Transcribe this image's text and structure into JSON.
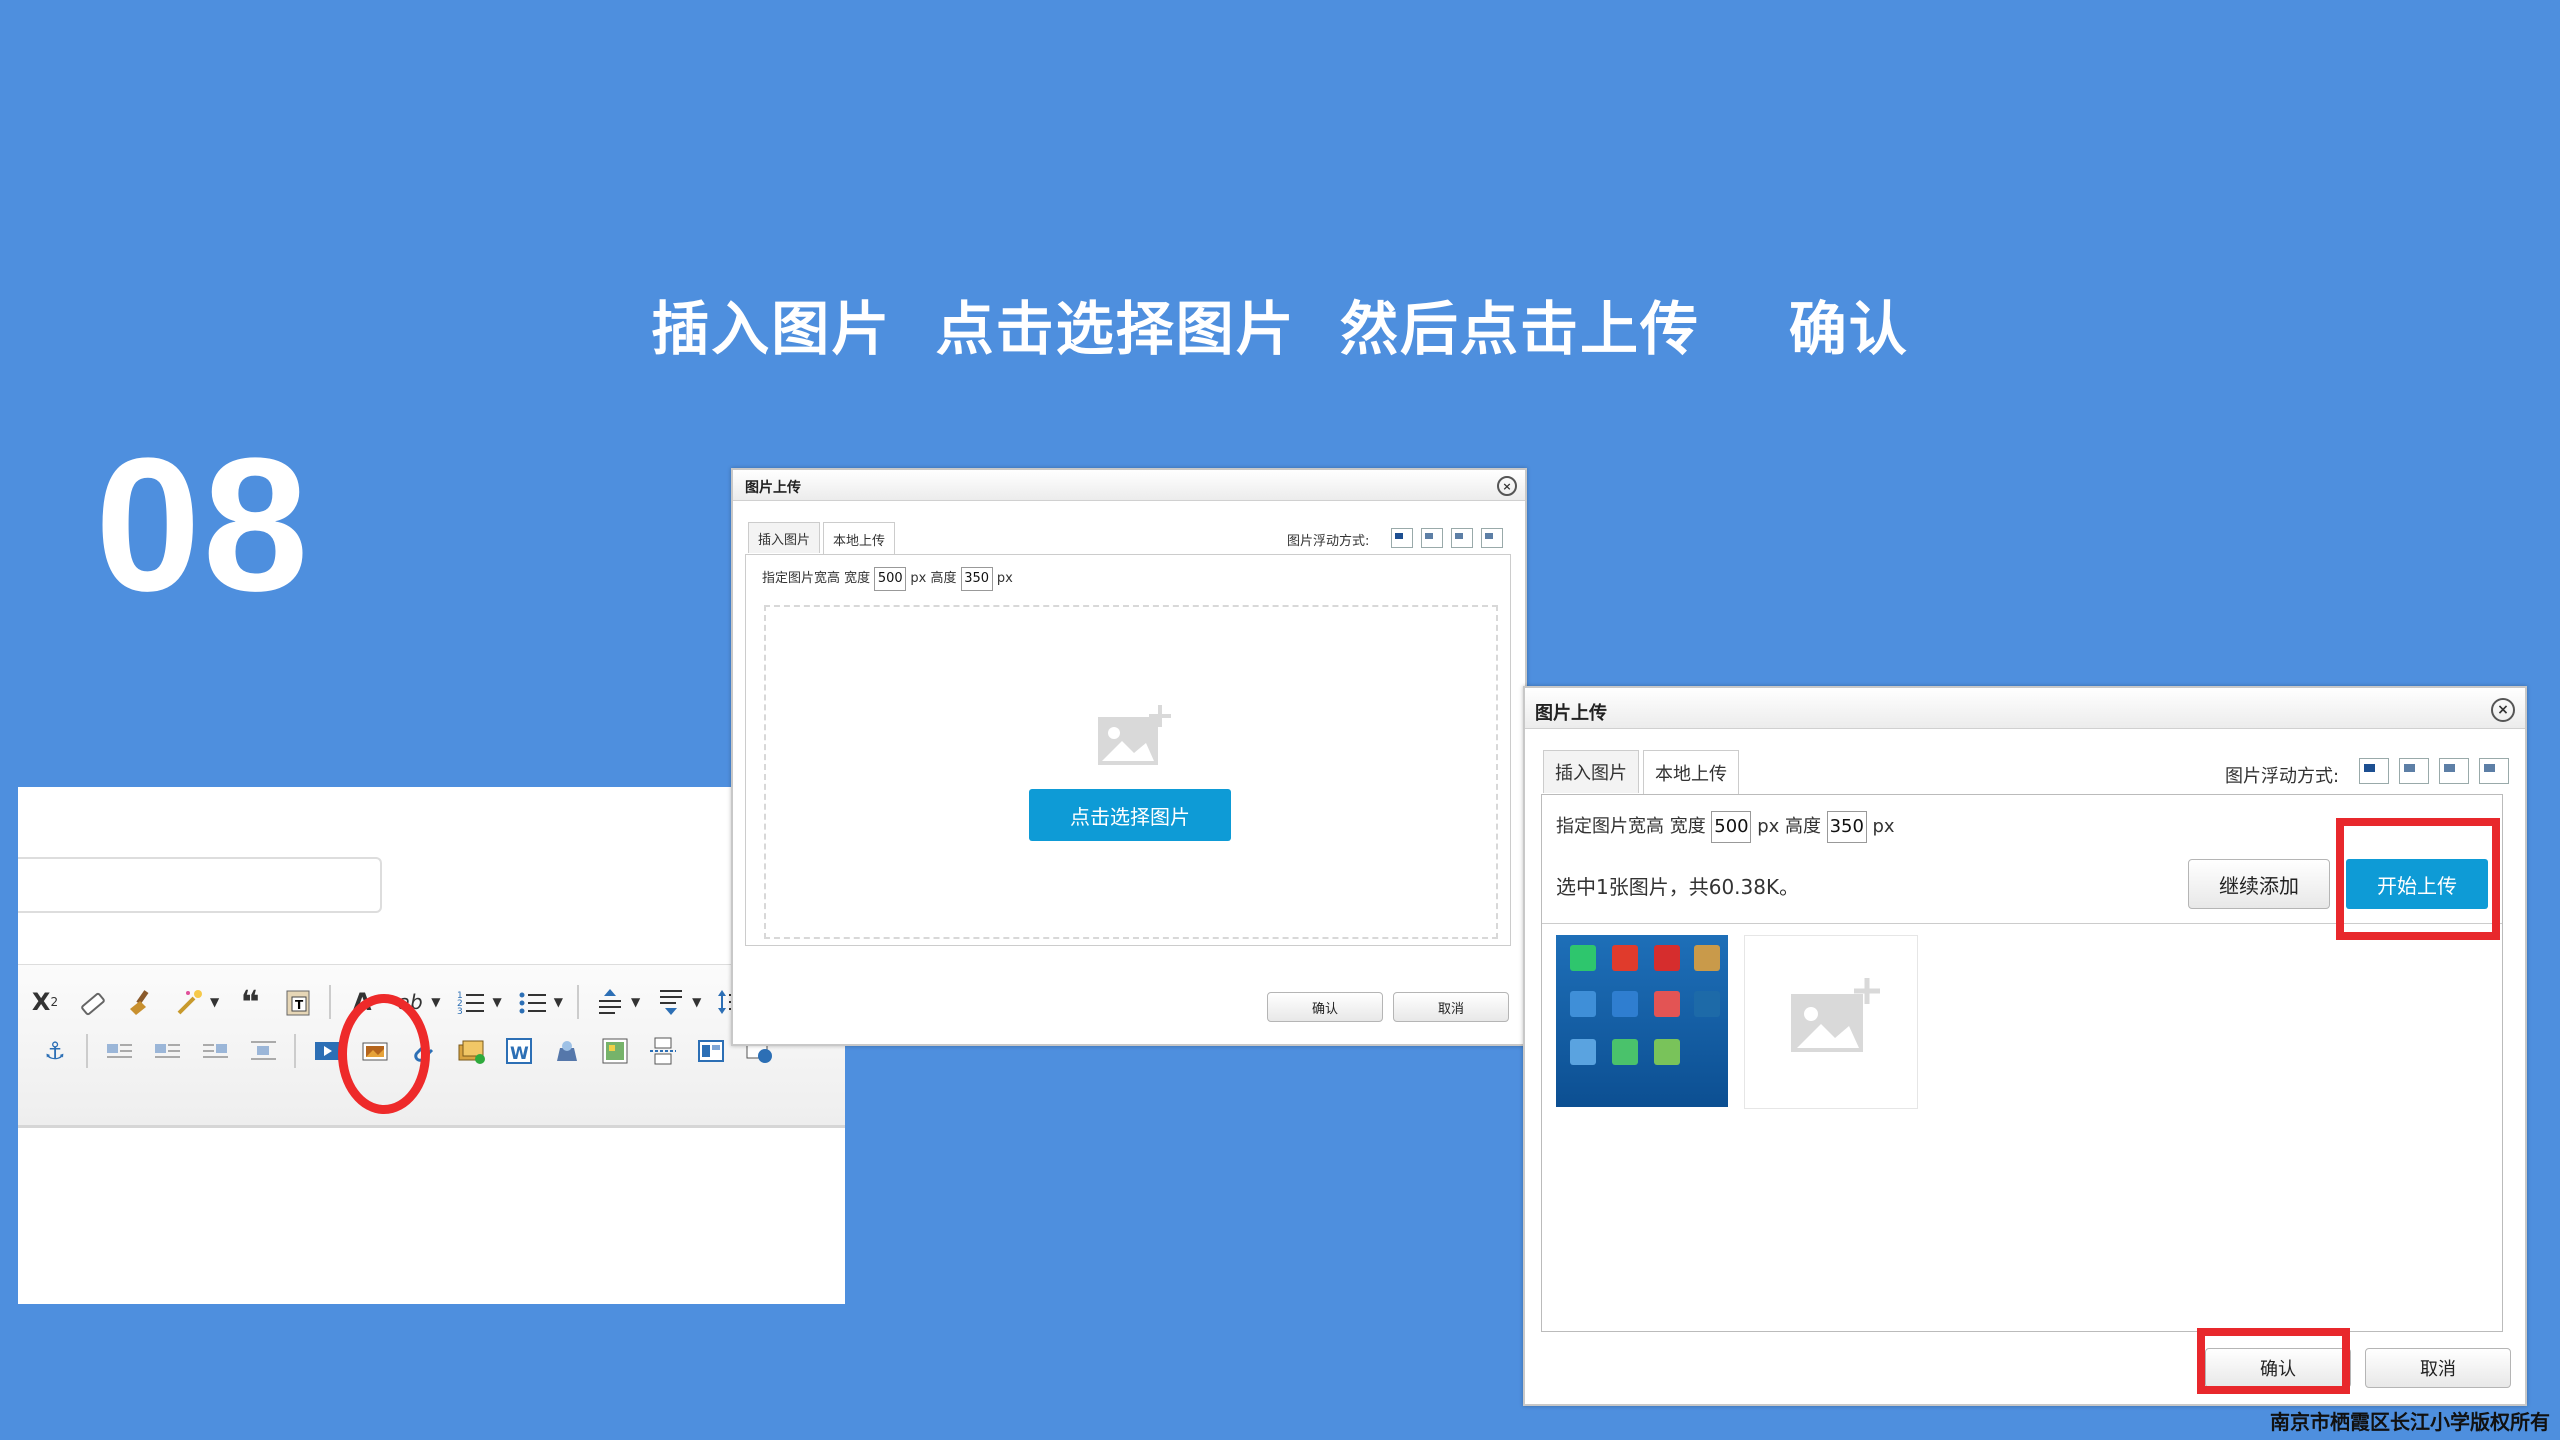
{
  "slide": {
    "step_number": "08",
    "title": "插入图片  点击选择图片  然后点击上传    确认",
    "copyright": "南京市栖霞区长江小学版权所有"
  },
  "dialog_select": {
    "title": "图片上传",
    "tabs": [
      "插入图片",
      "本地上传"
    ],
    "float_label": "图片浮动方式:",
    "size_label": "指定图片宽高 宽度",
    "width": "500",
    "px1": "px",
    "height_label": "高度",
    "height": "350",
    "px2": "px",
    "select_button": "点击选择图片",
    "ok": "确认",
    "cancel": "取消"
  },
  "dialog_upload": {
    "title": "图片上传",
    "tabs": [
      "插入图片",
      "本地上传"
    ],
    "float_label": "图片浮动方式:",
    "size_label": "指定图片宽高 宽度",
    "width": "500",
    "px1": "px",
    "height_label": "高度",
    "height": "350",
    "px2": "px",
    "status": "选中1张图片，共60.38K。",
    "continue_button": "继续添加",
    "start_upload_button": "开始上传",
    "ok": "确认",
    "cancel": "取消"
  },
  "colors": {
    "background": "#4e8fde",
    "accent_blue": "#0e9bd6",
    "highlight_red": "#e8282c"
  }
}
